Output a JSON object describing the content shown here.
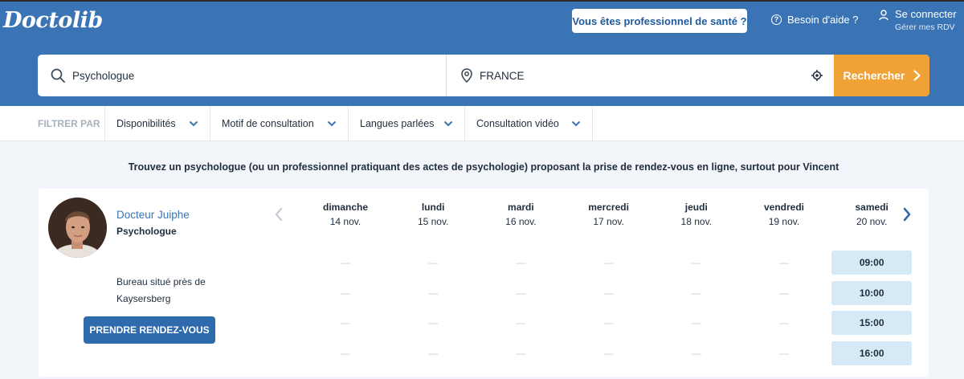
{
  "header": {
    "logo": "Doctolib",
    "pro_button": "Vous êtes professionnel de santé ?",
    "help": "Besoin d'aide ?",
    "login": "Se connecter",
    "login_sub": "Gérer mes RDV"
  },
  "search": {
    "speciality": "Psychologue",
    "location": "FRANCE",
    "submit": "Rechercher"
  },
  "filters": {
    "label": "FILTRER PAR",
    "items": [
      "Disponibilités",
      "Motif de consultation",
      "Langues parlées",
      "Consultation vidéo"
    ]
  },
  "subtitle": "Trouvez un psychologue (ou un professionnel pratiquant des actes de psychologie) proposant la prise de rendez-vous en ligne, surtout pour Vincent",
  "result": {
    "name": "Docteur Juiphe",
    "speciality": "Psychologue",
    "address_line1": "Bureau situé près de",
    "address_line2": "Kaysersberg",
    "book_button": "PRENDRE RENDEZ-VOUS",
    "empty_slot": "—",
    "days": [
      {
        "name": "dimanche",
        "date": "14 nov.",
        "slots": []
      },
      {
        "name": "lundi",
        "date": "15 nov.",
        "slots": []
      },
      {
        "name": "mardi",
        "date": "16 nov.",
        "slots": []
      },
      {
        "name": "mercredi",
        "date": "17 nov.",
        "slots": []
      },
      {
        "name": "jeudi",
        "date": "18 nov.",
        "slots": []
      },
      {
        "name": "vendredi",
        "date": "19 nov.",
        "slots": []
      },
      {
        "name": "samedi",
        "date": "20 nov.",
        "slots": [
          "09:00",
          "10:00",
          "15:00",
          "16:00"
        ]
      }
    ]
  },
  "colors": {
    "brand_blue": "#3a74b4",
    "search_orange": "#f0a236",
    "slot_bg": "#d6e9f7"
  }
}
